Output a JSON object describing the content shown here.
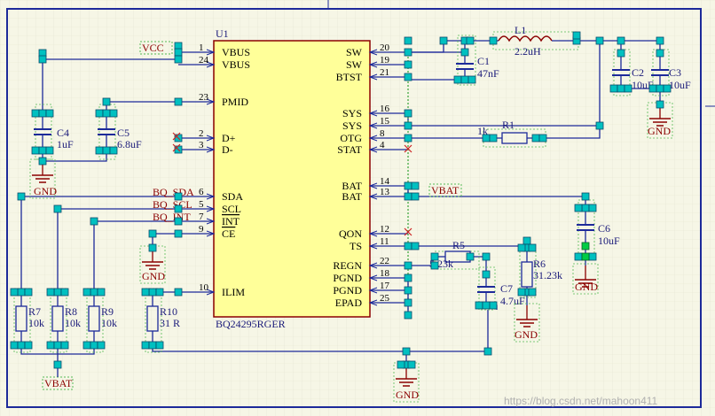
{
  "ic": {
    "ref": "U1",
    "part": "BQ24295RGER",
    "left_pins": [
      {
        "num": "1",
        "name": "VBUS"
      },
      {
        "num": "24",
        "name": "VBUS"
      },
      {
        "num": "23",
        "name": "PMID"
      },
      {
        "num": "2",
        "name": "D+"
      },
      {
        "num": "3",
        "name": "D-"
      },
      {
        "num": "6",
        "name": "SDA"
      },
      {
        "num": "5",
        "name": "SCL"
      },
      {
        "num": "7",
        "name": "INT"
      },
      {
        "num": "9",
        "name": "CE"
      },
      {
        "num": "10",
        "name": "ILIM"
      }
    ],
    "right_pins": [
      {
        "num": "20",
        "name": "SW"
      },
      {
        "num": "19",
        "name": "SW"
      },
      {
        "num": "21",
        "name": "BTST"
      },
      {
        "num": "16",
        "name": "SYS"
      },
      {
        "num": "15",
        "name": "SYS"
      },
      {
        "num": "8",
        "name": "OTG"
      },
      {
        "num": "4",
        "name": "STAT"
      },
      {
        "num": "14",
        "name": "BAT"
      },
      {
        "num": "13",
        "name": "BAT"
      },
      {
        "num": "12",
        "name": "QON"
      },
      {
        "num": "11",
        "name": "TS"
      },
      {
        "num": "22",
        "name": "REGN"
      },
      {
        "num": "18",
        "name": "PGND"
      },
      {
        "num": "17",
        "name": "PGND"
      },
      {
        "num": "25",
        "name": "EPAD"
      }
    ]
  },
  "net_labels": {
    "vcc": "VCC",
    "bq_sda": "BQ_SDA",
    "bq_scl": "BQ_SCL",
    "bq_int": "BQ_INT",
    "vbat_top": "VBAT",
    "vbat_bottom": "VBAT"
  },
  "components": {
    "c1": {
      "ref": "C1",
      "value": "47nF"
    },
    "c2": {
      "ref": "C2",
      "value": "10uF"
    },
    "c3": {
      "ref": "C3",
      "value": "10uF"
    },
    "c4": {
      "ref": "C4",
      "value": "1uF"
    },
    "c5": {
      "ref": "C5",
      "value": "6.8uF"
    },
    "c6": {
      "ref": "C6",
      "value": "10uF"
    },
    "c7": {
      "ref": "C7",
      "value": "4.7uF"
    },
    "l1": {
      "ref": "L1",
      "value": "2.2uH"
    },
    "r1": {
      "ref": "R1",
      "value": "1k"
    },
    "r5": {
      "ref": "R5",
      "value": "5.23k"
    },
    "r6": {
      "ref": "R6",
      "value": "31.23k"
    },
    "r7": {
      "ref": "R7",
      "value": "10k"
    },
    "r8": {
      "ref": "R8",
      "value": "10k"
    },
    "r9": {
      "ref": "R9",
      "value": "10k"
    },
    "r10": {
      "ref": "R10",
      "value": "31 R"
    }
  },
  "gnd_label": "GND",
  "watermark": "https://blog.csdn.net/mahoon411",
  "colors": {
    "background": "#f6f6e6",
    "wire": "#1d2a9a",
    "ic_fill": "#ffff99",
    "ic_border": "#8b0000",
    "pad": "#00c0c0",
    "netlabel": "#8b0000",
    "green_pad": "#00cc44"
  }
}
